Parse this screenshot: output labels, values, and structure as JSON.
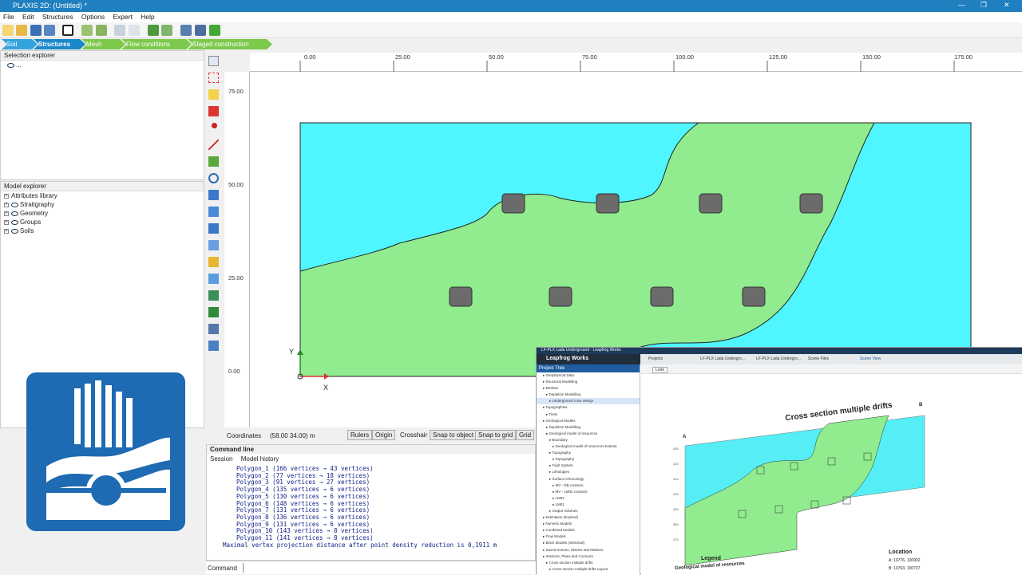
{
  "window": {
    "title": "PLAXIS 2D: (Untitled) *"
  },
  "menu": [
    "File",
    "Edit",
    "Structures",
    "Options",
    "Expert",
    "Help"
  ],
  "modes": [
    "Soil",
    "Structures",
    "Mesh",
    "Flow conditions",
    "Staged construction"
  ],
  "selection_explorer": {
    "title": "Selection explorer",
    "item": "..."
  },
  "model_explorer": {
    "title": "Model explorer",
    "items": [
      "Attributes library",
      "Stratigraphy",
      "Geometry",
      "Groups",
      "Soils"
    ]
  },
  "rulers": {
    "top": [
      "0.00",
      "25.00",
      "50.00",
      "75.00",
      "100.00",
      "125.00",
      "150.00",
      "175.00"
    ],
    "left": [
      "75.00",
      "50.00",
      "25.00",
      "0.00"
    ]
  },
  "axes": {
    "x": "X",
    "y": "Y"
  },
  "colors": {
    "soil_cyan": "#4ff5ff",
    "soil_green": "#90ec8e",
    "drift": "#6b6b6b",
    "accent": "#1f7fbf",
    "mode_green": "#7dc94b"
  },
  "status": {
    "coordinates_label": "Coordinates",
    "coordinates_value": "(58.00 34.00) m",
    "buttons": [
      "Rulers",
      "Origin",
      "Crosshair",
      "Snap to object",
      "Snap to grid",
      "Grid"
    ]
  },
  "command_line": {
    "title": "Command line",
    "tabs": [
      "Session",
      "Model history"
    ],
    "log": [
      "Polygon_1 (166 vertices → 43 vertices)",
      "Polygon_2 (77 vertices → 18 vertices)",
      "Polygon_3 (91 vertices → 27 vertices)",
      "Polygon_4 (135 vertices → 6 vertices)",
      "Polygon_5 (130 vertices → 6 vertices)",
      "Polygon_6 (148 vertices → 6 vertices)",
      "Polygon_7 (131 vertices → 6 vertices)",
      "Polygon_8 (136 vertices → 6 vertices)",
      "Polygon_9 (131 vertices → 6 vertices)",
      "Polygon_10 (143 vertices → 8 vertices)",
      "Polygon_11 (141 vertices → 8 vertices)",
      "Maximal vertex projection distance after point density reduction is 0,1911 m"
    ],
    "prompt_label": "Command"
  },
  "leapfrog": {
    "window_title": "LF-PLX Lada Underground - Leapfrog Works",
    "app_name": "Leapfrog Works",
    "tabs": [
      "Projects",
      "LF-PLX Lada Undergro...",
      "LF-PLX Lada Undergro...",
      "Scene Files",
      "Scene View"
    ],
    "project_tree_title": "Project Tree",
    "tree": [
      "Geophysical Data",
      "Structural Modelling",
      "Meshes",
      "Depletion Modelling",
      "Underground mine design",
      "Topographies",
      "Tines",
      "Geological Models",
      "Depletion Modelling",
      "Geological model of resources",
      "Boundary",
      "Geological model of resources Extents",
      "Topography",
      "Topography",
      "Fault System",
      "Lithologies",
      "Surface Chronology",
      "MV - DB contacts",
      "MV - LM02 contacts",
      "LM02",
      "LM01",
      "Output Volumes",
      "Estimation (Expired)",
      "Numeric Models",
      "Combined Models",
      "Flow Models",
      "Block Models (Selected)",
      "Saved Scenes, Movies and Markers",
      "Sections, Plans and Contours",
      "Cross section multiple drifts",
      "Cross section multiple drifts Layout"
    ],
    "view_dropdown": "Look",
    "section_title": "Cross section multiple drifts",
    "label_a": "A",
    "label_b": "B",
    "legend_title": "Legend",
    "legend_sub": "Geological model of resources",
    "location_title": "Location",
    "location_a": "A:  10776, 100902",
    "location_b": "B:  10763, 100737",
    "axis_ticks": [
      "430",
      "420",
      "410",
      "400",
      "390",
      "380",
      "370"
    ]
  }
}
